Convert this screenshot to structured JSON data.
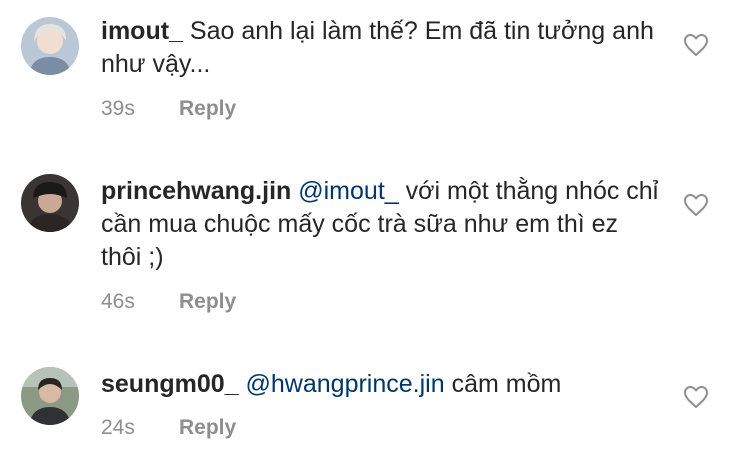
{
  "comments": [
    {
      "username": "imout_",
      "mention": "",
      "text": "Sao anh lại làm thế? Em đã tin tưởng anh như vậy...",
      "time": "39s",
      "reply_label": "Reply",
      "avatar": "avatar-light-hair"
    },
    {
      "username": "princehwang.jin",
      "mention": "@imout_",
      "text": "với một thằng nhóc chỉ cần mua chuộc mấy cốc trà sữa như em thì ez thôi ;)",
      "time": "46s",
      "reply_label": "Reply",
      "avatar": "avatar-dark-hat"
    },
    {
      "username": "seungm00_",
      "mention": "@hwangprince.jin",
      "text": "câm mồm",
      "time": "24s",
      "reply_label": "Reply",
      "avatar": "avatar-outdoor"
    }
  ],
  "icons": {
    "like": "heart-outline-icon"
  },
  "colors": {
    "username": "#262626",
    "mention": "#00376b",
    "meta": "#8e8e8e"
  }
}
